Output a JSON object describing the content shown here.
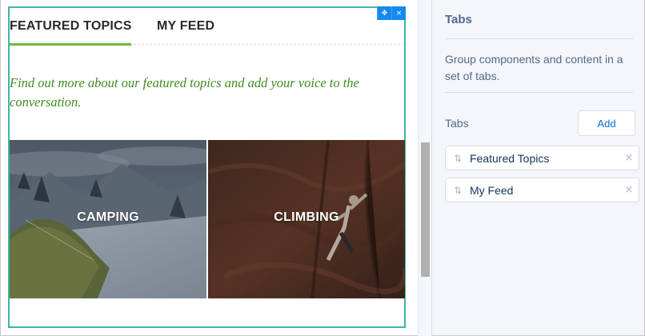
{
  "canvas": {
    "component_controls": {
      "move_glyph": "✥",
      "close_glyph": "×"
    },
    "tabs": [
      {
        "label": "FEATURED TOPICS",
        "active": true
      },
      {
        "label": "MY FEED",
        "active": false
      }
    ],
    "intro_text": "Find out more about our featured topics and add your voice to the conversation.",
    "topics": [
      {
        "label": "CAMPING"
      },
      {
        "label": "CLIMBING"
      }
    ]
  },
  "panel": {
    "title": "Tabs",
    "description": "Group components and content in a set of tabs.",
    "section_label": "Tabs",
    "add_button": "Add",
    "tab_items": [
      {
        "label": "Featured Topics",
        "drag_icon": "⇅",
        "remove_icon": "×"
      },
      {
        "label": "My Feed",
        "drag_icon": "⇅",
        "remove_icon": "×"
      }
    ]
  },
  "colors": {
    "frame_border": "#3fb6a3",
    "active_tab_underline": "#6dba3c",
    "intro_text": "#3f8d1e",
    "control_blue": "#1589ee",
    "panel_background": "#f4f6f9",
    "link_blue": "#0070d2"
  }
}
